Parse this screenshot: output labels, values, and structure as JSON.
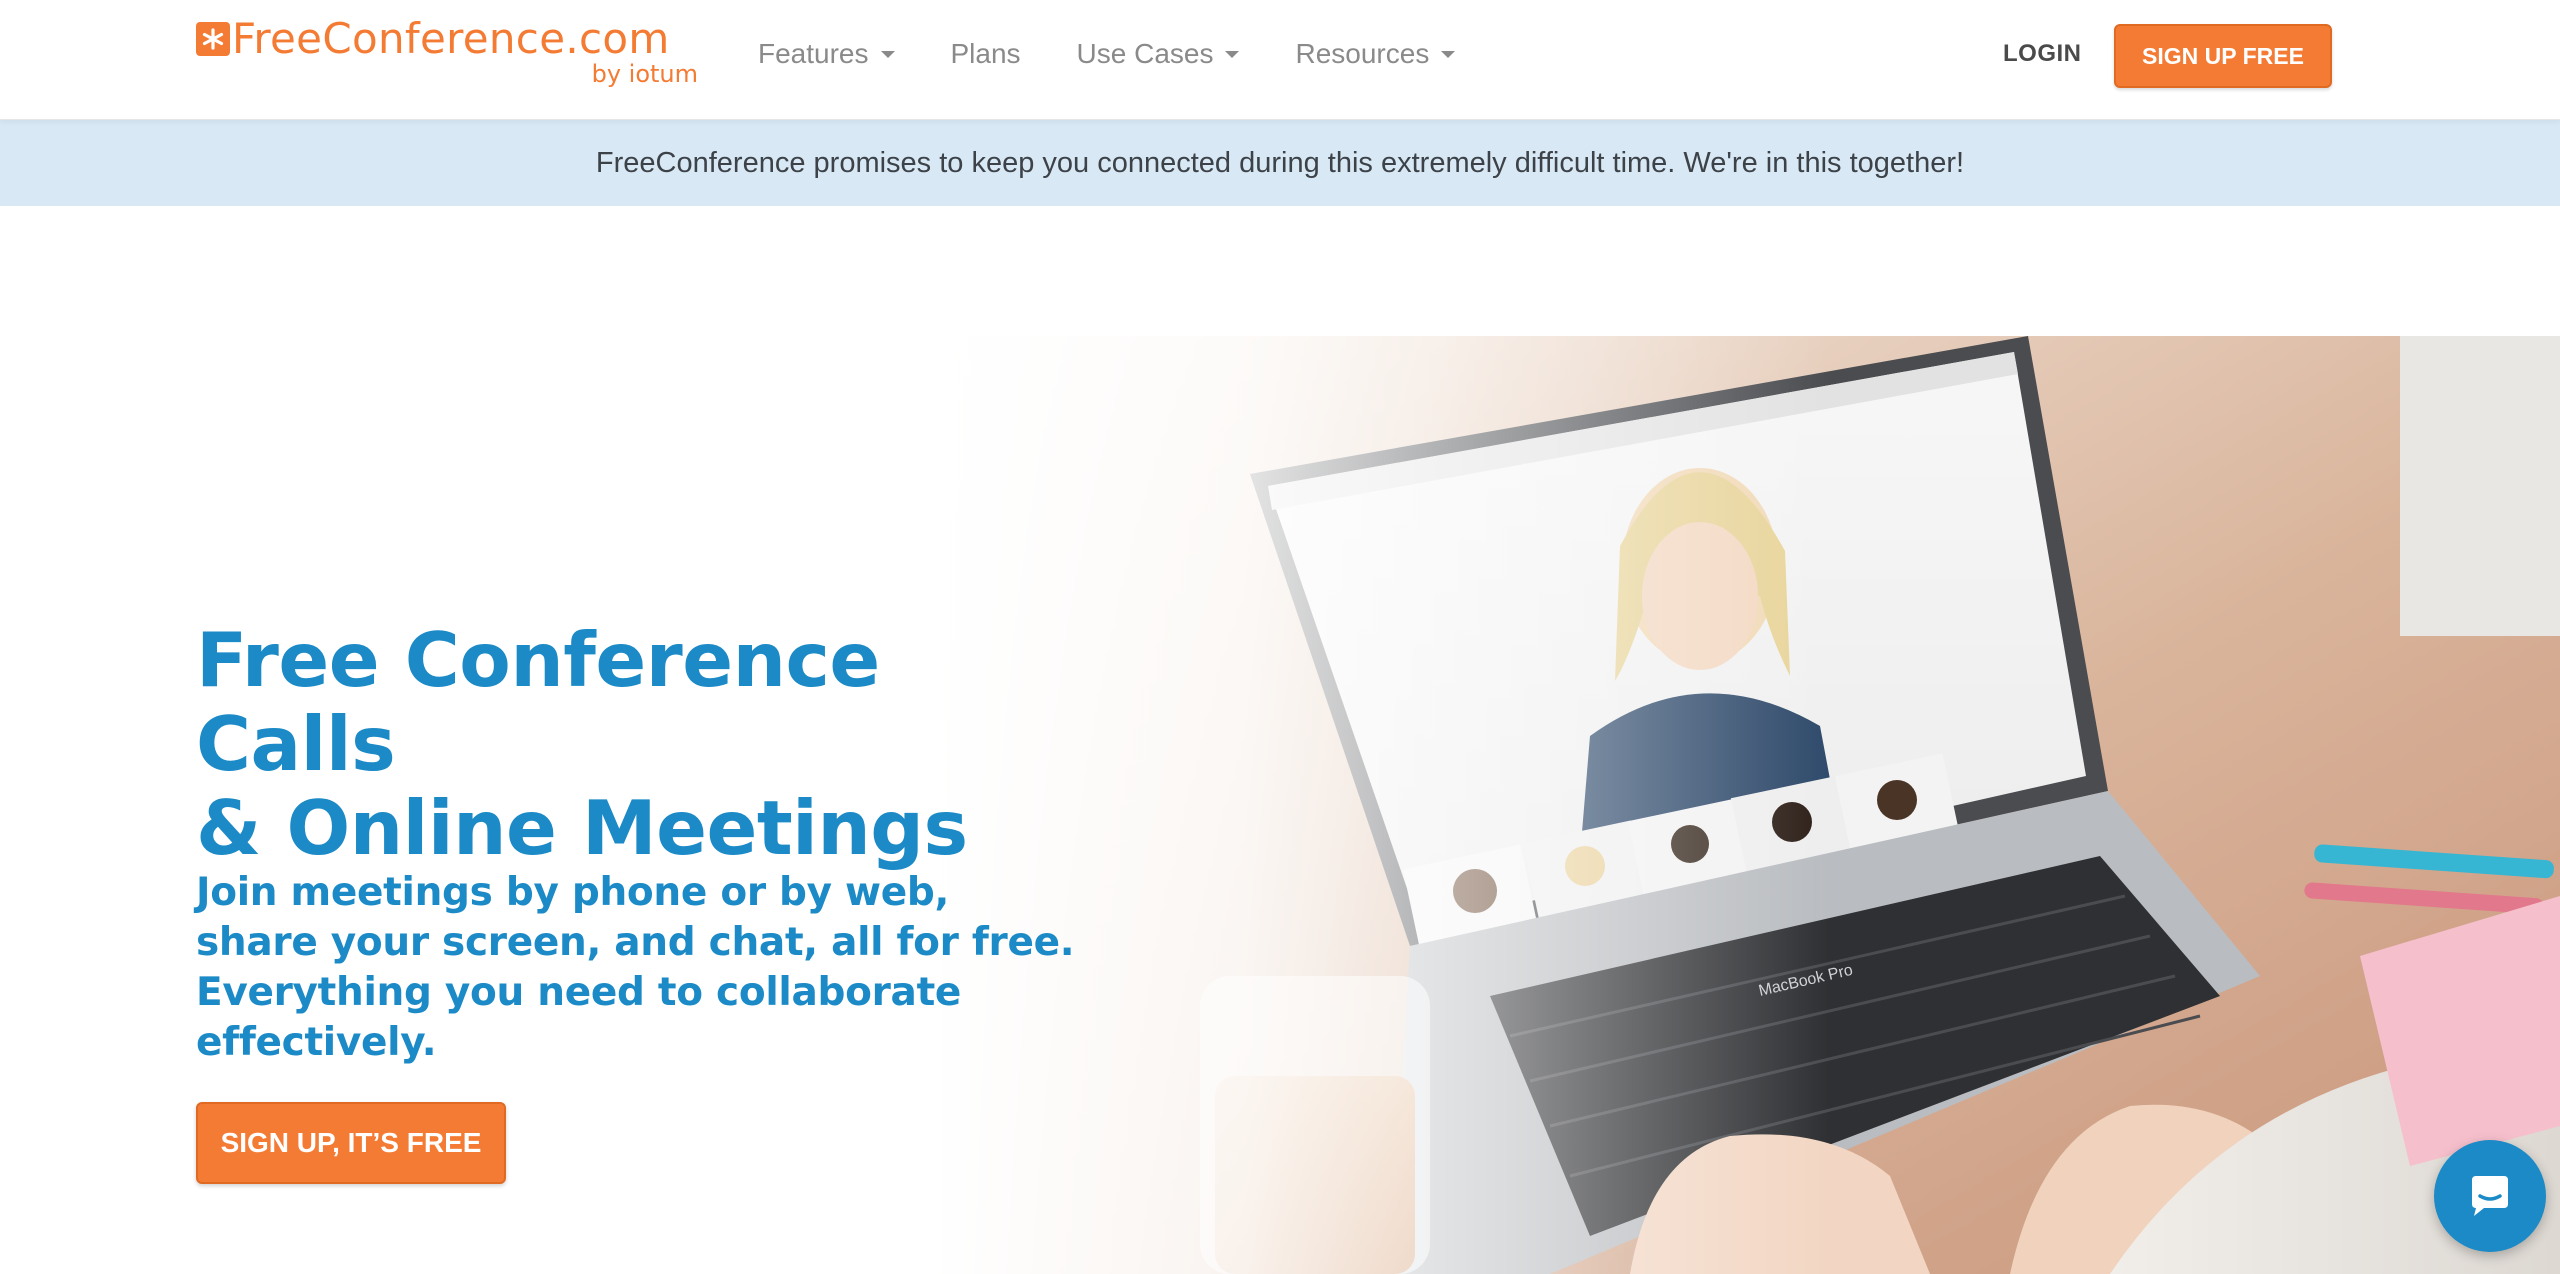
{
  "header": {
    "logo_text": "FreeConference.com",
    "logo_sub": "by iotum",
    "nav": [
      {
        "label": "Features",
        "has_dropdown": true
      },
      {
        "label": "Plans",
        "has_dropdown": false
      },
      {
        "label": "Use Cases",
        "has_dropdown": true
      },
      {
        "label": "Resources",
        "has_dropdown": true
      }
    ],
    "login_label": "LOGIN",
    "signup_label": "SIGN UP FREE"
  },
  "banner": {
    "text": "FreeConference promises to keep you connected during this extremely difficult time. We're in this together!"
  },
  "hero": {
    "title_line1": "Free Conference Calls",
    "title_line2": "& Online Meetings",
    "subtitle_line1": "Join meetings by phone or by web,",
    "subtitle_line2": "share your screen, and chat, all for free.",
    "subtitle_line3": "Everything you need to collaborate",
    "subtitle_line4": "effectively.",
    "cta_label": "SIGN UP, IT’S FREE",
    "laptop_label": "MacBook Pro"
  },
  "chat_widget": {
    "icon": "chat-bubble-icon"
  },
  "colors": {
    "brand_orange": "#f47b33",
    "brand_blue": "#1b8ac6",
    "banner_bg": "#d8e9f5",
    "nav_text": "#8a8a8a"
  }
}
